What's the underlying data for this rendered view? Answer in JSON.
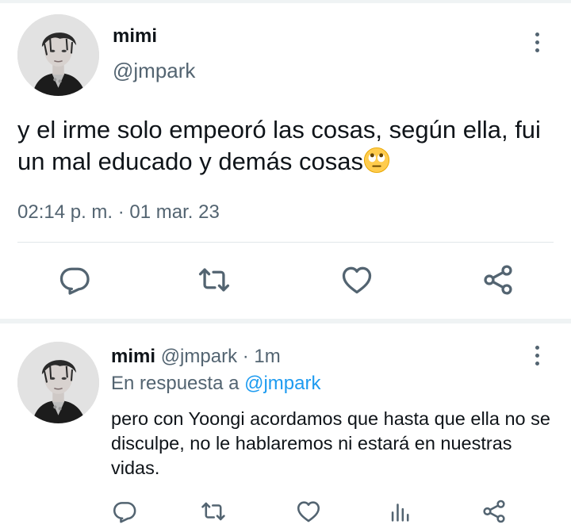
{
  "main_tweet": {
    "display_name": "mimi",
    "handle": "@jmpark",
    "text": "y el irme solo empeoró las cosas, según ella, fui un mal educado y demás cosas",
    "emoji": "face-with-rolling-eyes-icon",
    "timestamp": "02:14 p. m. · 01 mar. 23",
    "actions": [
      "reply-icon",
      "retweet-icon",
      "like-icon",
      "share-icon"
    ]
  },
  "reply_tweet": {
    "display_name": "mimi",
    "handle": "@jmpark",
    "separator": "·",
    "time_ago": "1m",
    "reply_prefix": "En respuesta a",
    "reply_to": "@jmpark",
    "text": "pero con Yoongi acordamos que hasta que ella no se disculpe, no le hablaremos ni estará en nuestras vidas.",
    "actions": [
      "reply-icon",
      "retweet-icon",
      "like-icon",
      "analytics-icon",
      "share-icon"
    ]
  },
  "colors": {
    "text_primary": "#0f1419",
    "text_secondary": "#536471",
    "link": "#1d9bf0",
    "divider": "#eff3f4"
  }
}
